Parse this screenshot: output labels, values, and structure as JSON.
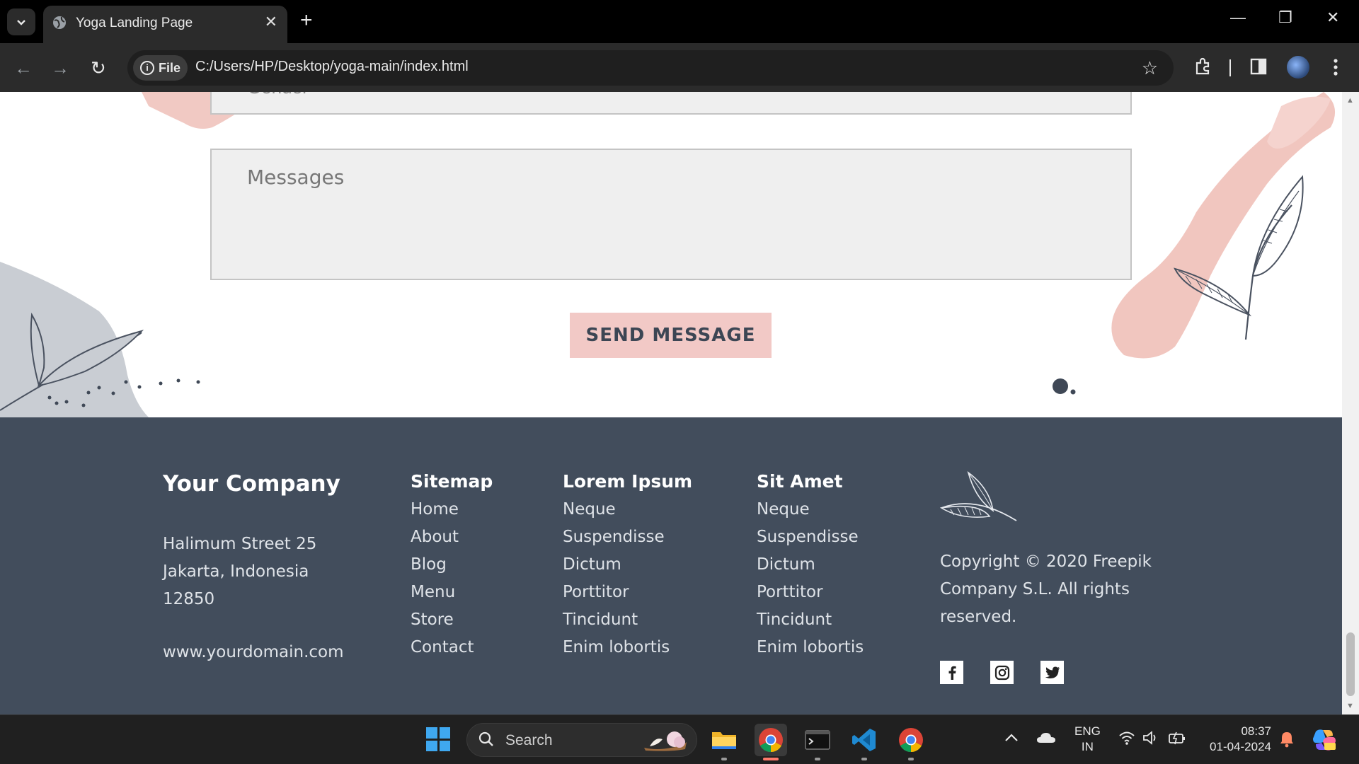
{
  "browser": {
    "tab_title": "Yoga Landing Page",
    "tab_close": "✕",
    "new_tab": "+",
    "file_chip": "File",
    "info_glyph": "i",
    "url": "C:/Users/HP/Desktop/yoga-main/index.html",
    "window_controls": {
      "minimize": "—",
      "restore": "❐",
      "close": "✕"
    },
    "nav": {
      "back": "←",
      "forward": "→",
      "reload": "↻"
    },
    "icons": {
      "tab_list": "chevron-down-icon",
      "favicon": "globe-icon",
      "bookmark": "star-icon",
      "extensions": "puzzle-icon",
      "side_panel": "side-panel-icon",
      "menu": "more-vert-icon"
    }
  },
  "form": {
    "gender_placeholder": "Gender",
    "messages_placeholder": "Messages",
    "send_button": "SEND MESSAGE"
  },
  "footer": {
    "company": {
      "name": "Your Company",
      "address_line1": "Halimum Street 25",
      "address_line2": "Jakarta, Indonesia",
      "address_line3": "12850",
      "website": "www.yourdomain.com"
    },
    "sitemap": {
      "title": "Sitemap",
      "items": [
        "Home",
        "About",
        "Blog",
        "Menu",
        "Store",
        "Contact"
      ]
    },
    "lorem": {
      "title": "Lorem Ipsum",
      "items": [
        "Neque",
        "Suspendisse",
        "Dictum",
        "Porttitor",
        "Tincidunt",
        "Enim lobortis"
      ]
    },
    "sit": {
      "title": "Sit Amet",
      "items": [
        "Neque",
        "Suspendisse",
        "Dictum",
        "Porttitor",
        "Tincidunt",
        "Enim lobortis"
      ]
    },
    "copyright_line1": "Copyright © 2020 Freepik",
    "copyright_line2": "Company S.L. All rights reserved.",
    "socials": [
      "facebook-icon",
      "instagram-icon",
      "twitter-icon"
    ]
  },
  "taskbar": {
    "search_label": "Search",
    "apps": [
      "file-explorer-icon",
      "chrome-icon",
      "terminal-icon",
      "vscode-icon",
      "chrome-icon"
    ],
    "lang_line1": "ENG",
    "lang_line2": "IN",
    "time": "08:37",
    "date": "01-04-2024"
  },
  "colors": {
    "footer_bg": "#424d5c",
    "button_bg": "#f2c9c6",
    "accent_pink": "#e9a9a0",
    "chrome_dark": "#2b2b2b"
  }
}
